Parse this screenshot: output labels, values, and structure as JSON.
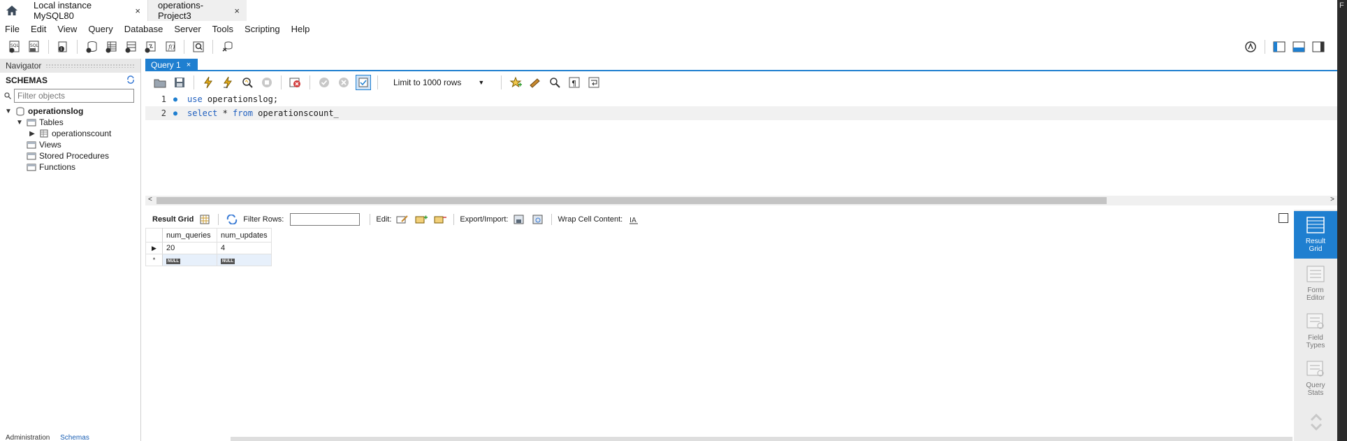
{
  "tabs": {
    "connection_tabs": [
      {
        "label": "Local instance MySQL80",
        "close": "×"
      },
      {
        "label": "operations-Project3",
        "close": "×"
      }
    ]
  },
  "right_edge_glyph": "F",
  "menu": [
    "File",
    "Edit",
    "View",
    "Query",
    "Database",
    "Server",
    "Tools",
    "Scripting",
    "Help"
  ],
  "navigator": {
    "title": "Navigator",
    "schemas_label": "SCHEMAS",
    "filter_placeholder": "Filter objects",
    "tree": {
      "schema": "operationslog",
      "tables_label": "Tables",
      "table": "operationscount",
      "views_label": "Views",
      "procedures_label": "Stored Procedures",
      "functions_label": "Functions"
    },
    "bottom_tabs": [
      "Administration",
      "Schemas"
    ]
  },
  "query_tab": {
    "label": "Query 1"
  },
  "editor_toolbar": {
    "limit_label": "Limit to 1000 rows"
  },
  "editor": {
    "lines": [
      {
        "num": "1",
        "kw": "use",
        "rest": " operationslog;"
      },
      {
        "num": "2",
        "kw1": "select",
        "mid": " * ",
        "kw2": "from",
        "rest": " operationscount"
      }
    ]
  },
  "result_toolbar": {
    "result_grid_label": "Result Grid",
    "filter_rows_label": "Filter Rows:",
    "edit_label": "Edit:",
    "export_label": "Export/Import:",
    "wrap_label": "Wrap Cell Content:"
  },
  "result_grid": {
    "columns": [
      "num_queries",
      "num_updates"
    ],
    "rows": [
      [
        "20",
        "4"
      ]
    ],
    "null_label": "NULL"
  },
  "side_panel": {
    "buttons": [
      {
        "label1": "Result",
        "label2": "Grid"
      },
      {
        "label1": "Form",
        "label2": "Editor"
      },
      {
        "label1": "Field",
        "label2": "Types"
      },
      {
        "label1": "Query",
        "label2": "Stats"
      }
    ]
  },
  "colors": {
    "accent": "#1f7fd0",
    "keyword": "#1f5fbf"
  }
}
